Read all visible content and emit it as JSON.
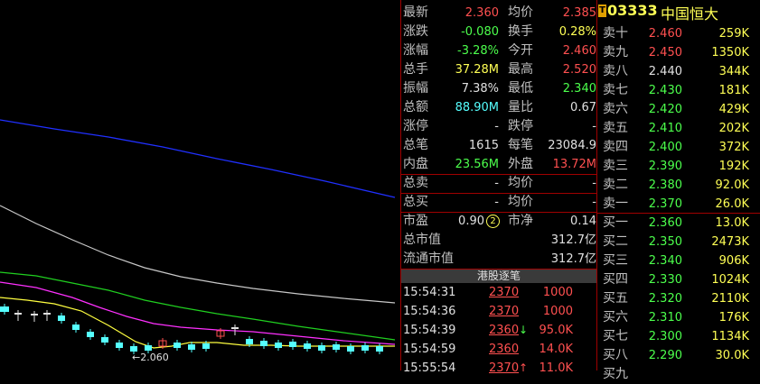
{
  "stock": {
    "code": "03333",
    "name": "中国恒大",
    "marker": "T"
  },
  "chart": {
    "low_marker": "←2.060"
  },
  "colors": {
    "up": "#ff5050",
    "down": "#4cff4c",
    "volume": "#ffff55",
    "amount": "#55ffff",
    "ma_blue": "#2030ff",
    "ma_white": "#c8c8c8",
    "ma_green": "#20d020",
    "ma_magenta": "#ff30ff",
    "ma_yellow": "#ffff40",
    "separator": "#a00000"
  },
  "quote": {
    "latest": {
      "label": "最新",
      "value": "2.360"
    },
    "avg_price": {
      "label": "均价",
      "value": "2.385"
    },
    "change": {
      "label": "涨跌",
      "value": "-0.080"
    },
    "turnover": {
      "label": "换手",
      "value": "0.28%"
    },
    "change_pct": {
      "label": "涨幅",
      "value": "-3.28%"
    },
    "open": {
      "label": "今开",
      "value": "2.460"
    },
    "volume": {
      "label": "总手",
      "value": "37.28M"
    },
    "high": {
      "label": "最高",
      "value": "2.520"
    },
    "amplitude": {
      "label": "振幅",
      "value": "7.38%"
    },
    "low": {
      "label": "最低",
      "value": "2.340"
    },
    "amount": {
      "label": "总额",
      "value": "88.90M"
    },
    "vol_ratio": {
      "label": "量比",
      "value": "0.67"
    },
    "limit_up": {
      "label": "涨停",
      "value": "-"
    },
    "limit_down": {
      "label": "跌停",
      "value": "-"
    },
    "trades": {
      "label": "总笔",
      "value": "1615"
    },
    "per_trade": {
      "label": "每笔",
      "value": "23084.9"
    },
    "inner": {
      "label": "内盘",
      "value": "23.56M"
    },
    "outer": {
      "label": "外盘",
      "value": "13.72M"
    },
    "total_sell": {
      "label": "总卖",
      "value": "-",
      "avg_label": "均价",
      "avg_value": "-"
    },
    "total_buy": {
      "label": "总买",
      "value": "-",
      "avg_label": "均价",
      "avg_value": "-"
    },
    "pe": {
      "label": "市盈",
      "value": "0.90",
      "badge": "2"
    },
    "pb": {
      "label": "市净",
      "value": "0.14"
    },
    "total_mv": {
      "label": "总市值",
      "value": "312.7亿"
    },
    "float_mv": {
      "label": "流通市值",
      "value": "312.7亿"
    }
  },
  "ticks": {
    "title": "港股逐笔",
    "rows": [
      {
        "time": "15:54:31",
        "price": "2370",
        "vol": "1000",
        "arrow": ""
      },
      {
        "time": "15:54:36",
        "price": "2370",
        "vol": "1000",
        "arrow": ""
      },
      {
        "time": "15:54:39",
        "price": "2360",
        "vol": "95.0K",
        "arrow": "↓"
      },
      {
        "time": "15:54:59",
        "price": "2360",
        "vol": "14.0K",
        "arrow": ""
      },
      {
        "time": "15:55:54",
        "price": "2370",
        "vol": "11.0K",
        "arrow": "↑"
      }
    ]
  },
  "orderbook": {
    "asks": [
      {
        "label": "卖十",
        "price": "2.460",
        "vol": "259K"
      },
      {
        "label": "卖九",
        "price": "2.450",
        "vol": "1350K"
      },
      {
        "label": "卖八",
        "price": "2.440",
        "vol": "344K"
      },
      {
        "label": "卖七",
        "price": "2.430",
        "vol": "181K"
      },
      {
        "label": "卖六",
        "price": "2.420",
        "vol": "429K"
      },
      {
        "label": "卖五",
        "price": "2.410",
        "vol": "202K"
      },
      {
        "label": "卖四",
        "price": "2.400",
        "vol": "372K"
      },
      {
        "label": "卖三",
        "price": "2.390",
        "vol": "192K"
      },
      {
        "label": "卖二",
        "price": "2.380",
        "vol": "92.0K"
      },
      {
        "label": "卖一",
        "price": "2.370",
        "vol": "26.0K"
      }
    ],
    "bids": [
      {
        "label": "买一",
        "price": "2.360",
        "vol": "13.0K"
      },
      {
        "label": "买二",
        "price": "2.350",
        "vol": "2473K"
      },
      {
        "label": "买三",
        "price": "2.340",
        "vol": "906K"
      },
      {
        "label": "买四",
        "price": "2.330",
        "vol": "1024K"
      },
      {
        "label": "买五",
        "price": "2.320",
        "vol": "2110K"
      },
      {
        "label": "买六",
        "price": "2.310",
        "vol": "176K"
      },
      {
        "label": "买七",
        "price": "2.300",
        "vol": "1134K"
      },
      {
        "label": "买八",
        "price": "2.290",
        "vol": "30.0K"
      },
      {
        "label": "买九",
        "price": "",
        "vol": ""
      }
    ]
  }
}
